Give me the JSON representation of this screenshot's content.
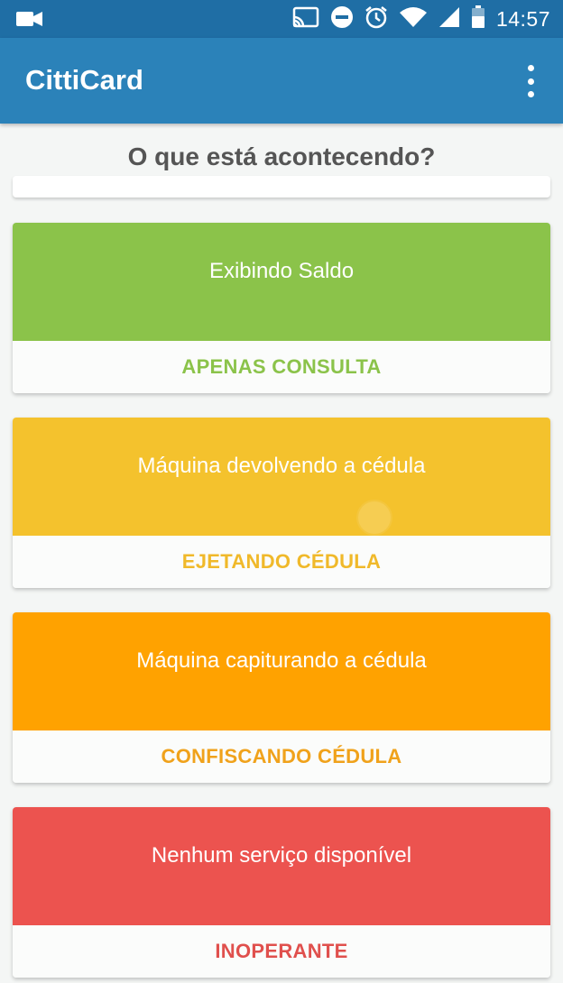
{
  "status_bar": {
    "time": "14:57",
    "icons": [
      "video-camera-icon",
      "cast-icon",
      "do-not-disturb-icon",
      "alarm-icon",
      "wifi-icon",
      "signal-icon",
      "battery-icon"
    ]
  },
  "app_bar": {
    "title": "CittiCard",
    "menu_icon": "overflow-menu-icon"
  },
  "header": {
    "title": "O que está acontecendo?"
  },
  "cards": [
    {
      "description": "Exibindo Saldo",
      "action": "APENAS CONSULTA",
      "color": "#8bc34a"
    },
    {
      "description": "Máquina devolvendo a cédula",
      "action": "EJETANDO CÉDULA",
      "color": "#f4c22d"
    },
    {
      "description": "Máquina capiturando a cédula",
      "action": "CONFISCANDO CÉDULA",
      "color": "#ffa200"
    },
    {
      "description": "Nenhum serviço disponível",
      "action": "INOPERANTE",
      "color": "#ec534f"
    }
  ],
  "colors": {
    "status_bar": "#1f6ea5",
    "app_bar": "#2b82b9",
    "background": "#f4f6f5",
    "card_green": "#8bc34a",
    "card_yellow": "#f4c22d",
    "card_orange": "#ffa200",
    "card_red": "#ec534f"
  }
}
